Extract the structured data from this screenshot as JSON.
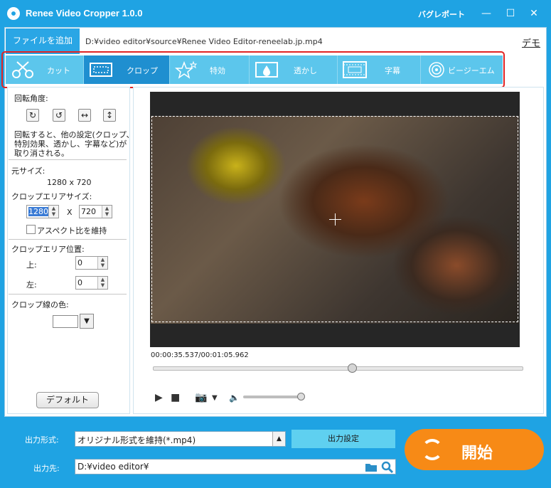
{
  "titlebar": {
    "title": "Renee Video Cropper 1.0.0",
    "bug_report": "バグレポート",
    "minimize": "—",
    "maximize": "☐",
    "close": "✕"
  },
  "file": {
    "add_button": "ファイルを追加",
    "path": "D:¥video editor¥source¥Renee Video Editor-reneelab.jp.mp4",
    "demo": "デモ"
  },
  "toolbar": {
    "items": [
      {
        "label": "カット",
        "icon": "scissors-icon",
        "active": false
      },
      {
        "label": "クロップ",
        "icon": "crop-icon",
        "active": true
      },
      {
        "label": "特効",
        "icon": "stars-icon",
        "active": false
      },
      {
        "label": "透かし",
        "icon": "watermark-icon",
        "active": false
      },
      {
        "label": "字幕",
        "icon": "subtitle-icon",
        "active": false
      },
      {
        "label": "ビージーエム",
        "icon": "music-icon",
        "active": false
      }
    ]
  },
  "settings": {
    "rotate_label": "回転角度:",
    "rotate_note_1": "回転すると、他の設定(クロップ、",
    "rotate_note_2": "特別効果、透かし、字幕など)が",
    "rotate_note_3": "取り消される。",
    "orig_size_label": "元サイズ:",
    "orig_size_value": "1280 x 720",
    "crop_size_label": "クロップエリアサイズ:",
    "crop_width": "1280",
    "crop_x": "X",
    "crop_height": "720",
    "keep_aspect": "アスペクト比を維持",
    "crop_pos_label": "クロップエリア位置:",
    "top_label": "上:",
    "top_value": "0",
    "left_label": "左:",
    "left_value": "0",
    "line_color_label": "クロップ線の色:",
    "line_color": "#ffffff",
    "default_button": "デフォルト"
  },
  "player": {
    "time": "00:00:35.537/00:01:05.962",
    "progress": 0.539,
    "volume": 0.95
  },
  "output": {
    "format_label": "出力形式:",
    "format_value": "オリジナル形式を維持(*.mp4)",
    "settings_button": "出力設定",
    "dest_label": "出力先:",
    "dest_value": "D:¥video editor¥",
    "start_button": "開始"
  },
  "colors": {
    "brand": "#1fa3e3",
    "toolbar": "#5cc6ec",
    "active_tool": "#1f8fd0",
    "start": "#f78a16",
    "highlight_frame": "#e02424"
  }
}
